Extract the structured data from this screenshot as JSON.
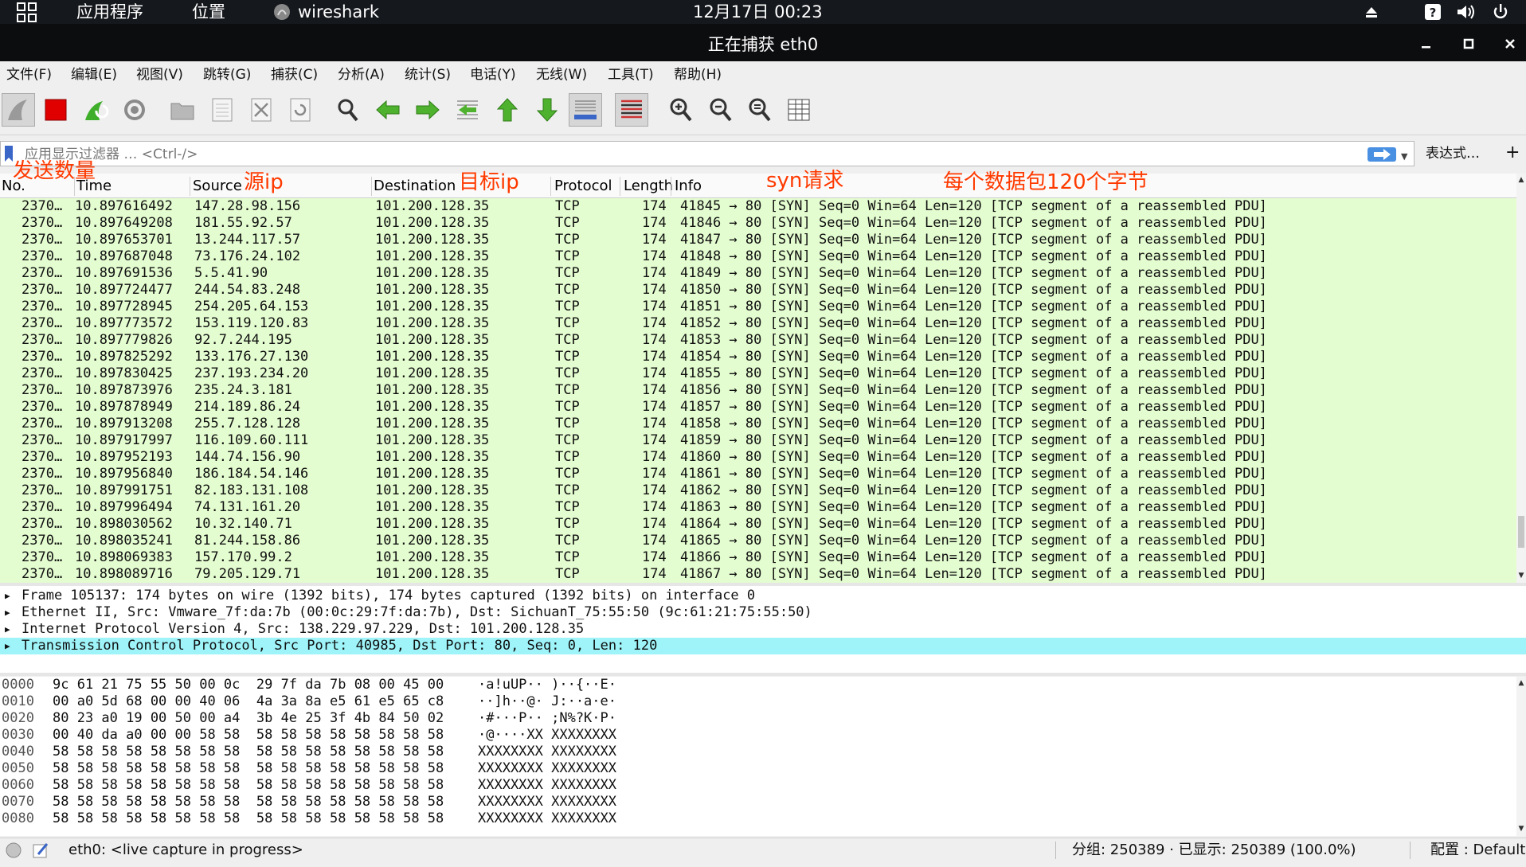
{
  "topbar": {
    "apps": "应用程序",
    "places": "位置",
    "app_name": "wireshark",
    "datetime": "12月17日  00:23"
  },
  "window": {
    "title": "正在捕获 eth0"
  },
  "menu": [
    "文件(F)",
    "编辑(E)",
    "视图(V)",
    "跳转(G)",
    "捕获(C)",
    "分析(A)",
    "统计(S)",
    "电话(Y)",
    "无线(W)",
    "工具(T)",
    "帮助(H)"
  ],
  "toolbar": {
    "icons": [
      "shark-fin-start-icon",
      "stop-square-icon",
      "restart-capture-icon",
      "capture-options-gear-icon",
      "open-folder-icon",
      "save-file-icon",
      "close-file-icon",
      "reload-icon",
      "find-magnifier-icon",
      "go-back-arrow-icon",
      "go-forward-arrow-icon",
      "go-to-packet-icon",
      "go-first-icon",
      "go-last-icon",
      "autoscroll-icon",
      "colorize-icon",
      "zoom-in-icon",
      "zoom-out-icon",
      "zoom-normal-icon",
      "resize-columns-icon"
    ]
  },
  "filter": {
    "placeholder": "应用显示过滤器 … <Ctrl-/>",
    "expression_label": "表达式…",
    "add_label": "+"
  },
  "columns": [
    "No.",
    "Time",
    "Source",
    "Destination",
    "Protocol",
    "Length",
    "Info"
  ],
  "annotations": {
    "count": "发送数量",
    "source": "源ip",
    "destination": "目标ip",
    "syn": "syn请求",
    "bytes": "每个数据包120个字节"
  },
  "packets": [
    {
      "no": "2370…",
      "time": "10.897616492",
      "src": "147.28.98.156",
      "dst": "101.200.128.35",
      "proto": "TCP",
      "len": "174",
      "info": "41845 → 80 [SYN] Seq=0 Win=64 Len=120 [TCP segment of a reassembled PDU]"
    },
    {
      "no": "2370…",
      "time": "10.897649208",
      "src": "181.55.92.57",
      "dst": "101.200.128.35",
      "proto": "TCP",
      "len": "174",
      "info": "41846 → 80 [SYN] Seq=0 Win=64 Len=120 [TCP segment of a reassembled PDU]"
    },
    {
      "no": "2370…",
      "time": "10.897653701",
      "src": "13.244.117.57",
      "dst": "101.200.128.35",
      "proto": "TCP",
      "len": "174",
      "info": "41847 → 80 [SYN] Seq=0 Win=64 Len=120 [TCP segment of a reassembled PDU]"
    },
    {
      "no": "2370…",
      "time": "10.897687048",
      "src": "73.176.24.102",
      "dst": "101.200.128.35",
      "proto": "TCP",
      "len": "174",
      "info": "41848 → 80 [SYN] Seq=0 Win=64 Len=120 [TCP segment of a reassembled PDU]"
    },
    {
      "no": "2370…",
      "time": "10.897691536",
      "src": "5.5.41.90",
      "dst": "101.200.128.35",
      "proto": "TCP",
      "len": "174",
      "info": "41849 → 80 [SYN] Seq=0 Win=64 Len=120 [TCP segment of a reassembled PDU]"
    },
    {
      "no": "2370…",
      "time": "10.897724477",
      "src": "244.54.83.248",
      "dst": "101.200.128.35",
      "proto": "TCP",
      "len": "174",
      "info": "41850 → 80 [SYN] Seq=0 Win=64 Len=120 [TCP segment of a reassembled PDU]"
    },
    {
      "no": "2370…",
      "time": "10.897728945",
      "src": "254.205.64.153",
      "dst": "101.200.128.35",
      "proto": "TCP",
      "len": "174",
      "info": "41851 → 80 [SYN] Seq=0 Win=64 Len=120 [TCP segment of a reassembled PDU]"
    },
    {
      "no": "2370…",
      "time": "10.897773572",
      "src": "153.119.120.83",
      "dst": "101.200.128.35",
      "proto": "TCP",
      "len": "174",
      "info": "41852 → 80 [SYN] Seq=0 Win=64 Len=120 [TCP segment of a reassembled PDU]"
    },
    {
      "no": "2370…",
      "time": "10.897779826",
      "src": "92.7.244.195",
      "dst": "101.200.128.35",
      "proto": "TCP",
      "len": "174",
      "info": "41853 → 80 [SYN] Seq=0 Win=64 Len=120 [TCP segment of a reassembled PDU]"
    },
    {
      "no": "2370…",
      "time": "10.897825292",
      "src": "133.176.27.130",
      "dst": "101.200.128.35",
      "proto": "TCP",
      "len": "174",
      "info": "41854 → 80 [SYN] Seq=0 Win=64 Len=120 [TCP segment of a reassembled PDU]"
    },
    {
      "no": "2370…",
      "time": "10.897830425",
      "src": "237.193.234.20",
      "dst": "101.200.128.35",
      "proto": "TCP",
      "len": "174",
      "info": "41855 → 80 [SYN] Seq=0 Win=64 Len=120 [TCP segment of a reassembled PDU]"
    },
    {
      "no": "2370…",
      "time": "10.897873976",
      "src": "235.24.3.181",
      "dst": "101.200.128.35",
      "proto": "TCP",
      "len": "174",
      "info": "41856 → 80 [SYN] Seq=0 Win=64 Len=120 [TCP segment of a reassembled PDU]"
    },
    {
      "no": "2370…",
      "time": "10.897878949",
      "src": "214.189.86.24",
      "dst": "101.200.128.35",
      "proto": "TCP",
      "len": "174",
      "info": "41857 → 80 [SYN] Seq=0 Win=64 Len=120 [TCP segment of a reassembled PDU]"
    },
    {
      "no": "2370…",
      "time": "10.897913208",
      "src": "255.7.128.128",
      "dst": "101.200.128.35",
      "proto": "TCP",
      "len": "174",
      "info": "41858 → 80 [SYN] Seq=0 Win=64 Len=120 [TCP segment of a reassembled PDU]"
    },
    {
      "no": "2370…",
      "time": "10.897917997",
      "src": "116.109.60.111",
      "dst": "101.200.128.35",
      "proto": "TCP",
      "len": "174",
      "info": "41859 → 80 [SYN] Seq=0 Win=64 Len=120 [TCP segment of a reassembled PDU]"
    },
    {
      "no": "2370…",
      "time": "10.897952193",
      "src": "144.74.156.90",
      "dst": "101.200.128.35",
      "proto": "TCP",
      "len": "174",
      "info": "41860 → 80 [SYN] Seq=0 Win=64 Len=120 [TCP segment of a reassembled PDU]"
    },
    {
      "no": "2370…",
      "time": "10.897956840",
      "src": "186.184.54.146",
      "dst": "101.200.128.35",
      "proto": "TCP",
      "len": "174",
      "info": "41861 → 80 [SYN] Seq=0 Win=64 Len=120 [TCP segment of a reassembled PDU]"
    },
    {
      "no": "2370…",
      "time": "10.897991751",
      "src": "82.183.131.108",
      "dst": "101.200.128.35",
      "proto": "TCP",
      "len": "174",
      "info": "41862 → 80 [SYN] Seq=0 Win=64 Len=120 [TCP segment of a reassembled PDU]"
    },
    {
      "no": "2370…",
      "time": "10.897996494",
      "src": "74.131.161.20",
      "dst": "101.200.128.35",
      "proto": "TCP",
      "len": "174",
      "info": "41863 → 80 [SYN] Seq=0 Win=64 Len=120 [TCP segment of a reassembled PDU]"
    },
    {
      "no": "2370…",
      "time": "10.898030562",
      "src": "10.32.140.71",
      "dst": "101.200.128.35",
      "proto": "TCP",
      "len": "174",
      "info": "41864 → 80 [SYN] Seq=0 Win=64 Len=120 [TCP segment of a reassembled PDU]"
    },
    {
      "no": "2370…",
      "time": "10.898035241",
      "src": "81.244.158.86",
      "dst": "101.200.128.35",
      "proto": "TCP",
      "len": "174",
      "info": "41865 → 80 [SYN] Seq=0 Win=64 Len=120 [TCP segment of a reassembled PDU]"
    },
    {
      "no": "2370…",
      "time": "10.898069383",
      "src": "157.170.99.2",
      "dst": "101.200.128.35",
      "proto": "TCP",
      "len": "174",
      "info": "41866 → 80 [SYN] Seq=0 Win=64 Len=120 [TCP segment of a reassembled PDU]"
    },
    {
      "no": "2370…",
      "time": "10.898089716",
      "src": "79.205.129.71",
      "dst": "101.200.128.35",
      "proto": "TCP",
      "len": "174",
      "info": "41867 → 80 [SYN] Seq=0 Win=64 Len=120 [TCP segment of a reassembled PDU]"
    }
  ],
  "details": [
    "Frame 105137: 174 bytes on wire (1392 bits), 174 bytes captured (1392 bits) on interface 0",
    "Ethernet II, Src: Vmware_7f:da:7b (00:0c:29:7f:da:7b), Dst: SichuanT_75:55:50 (9c:61:21:75:55:50)",
    "Internet Protocol Version 4, Src: 138.229.97.229, Dst: 101.200.128.35",
    "Transmission Control Protocol, Src Port: 40985, Dst Port: 80, Seq: 0, Len: 120"
  ],
  "hex": [
    {
      "off": "0000",
      "hex": "9c 61 21 75 55 50 00 0c  29 7f da 7b 08 00 45 00",
      "ascii": "·a!uUP·· )··{··E·"
    },
    {
      "off": "0010",
      "hex": "00 a0 5d 68 00 00 40 06  4a 3a 8a e5 61 e5 65 c8",
      "ascii": "··]h··@· J:··a·e·"
    },
    {
      "off": "0020",
      "hex": "80 23 a0 19 00 50 00 a4  3b 4e 25 3f 4b 84 50 02",
      "ascii": "·#···P·· ;N%?K·P·"
    },
    {
      "off": "0030",
      "hex": "00 40 da a0 00 00 58 58  58 58 58 58 58 58 58 58",
      "ascii": "·@····XX XXXXXXXX"
    },
    {
      "off": "0040",
      "hex": "58 58 58 58 58 58 58 58  58 58 58 58 58 58 58 58",
      "ascii": "XXXXXXXX XXXXXXXX"
    },
    {
      "off": "0050",
      "hex": "58 58 58 58 58 58 58 58  58 58 58 58 58 58 58 58",
      "ascii": "XXXXXXXX XXXXXXXX"
    },
    {
      "off": "0060",
      "hex": "58 58 58 58 58 58 58 58  58 58 58 58 58 58 58 58",
      "ascii": "XXXXXXXX XXXXXXXX"
    },
    {
      "off": "0070",
      "hex": "58 58 58 58 58 58 58 58  58 58 58 58 58 58 58 58",
      "ascii": "XXXXXXXX XXXXXXXX"
    },
    {
      "off": "0080",
      "hex": "58 58 58 58 58 58 58 58  58 58 58 58 58 58 58 58",
      "ascii": "XXXXXXXX XXXXXXXX"
    }
  ],
  "status": {
    "capture": "eth0: <live capture in progress>",
    "packets": "分组: 250389 · 已显示: 250389 (100.0%)",
    "profile": "配置 : Default"
  },
  "colors": {
    "packet_row_bg": "#e4fdd0",
    "selected_detail_bg": "#9ef4f9",
    "annotation": "#ff3a00",
    "stop_red": "#e00000"
  }
}
